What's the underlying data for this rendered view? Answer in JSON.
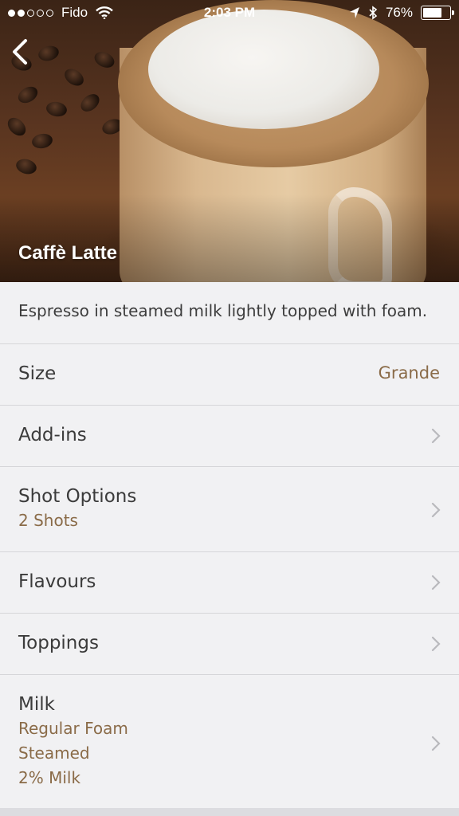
{
  "status_bar": {
    "carrier": "Fido",
    "time": "2:03 PM",
    "battery_percent": "76%",
    "battery_level": 0.76
  },
  "product": {
    "title": "Caffè Latte",
    "description": "Espresso in steamed milk lightly topped with foam."
  },
  "options": {
    "size": {
      "label": "Size",
      "value": "Grande"
    },
    "add_ins": {
      "label": "Add-ins"
    },
    "shot_options": {
      "label": "Shot Options",
      "sub": [
        "2 Shots"
      ]
    },
    "flavours": {
      "label": "Flavours"
    },
    "toppings": {
      "label": "Toppings"
    },
    "milk": {
      "label": "Milk",
      "sub": [
        "Regular Foam",
        "Steamed",
        "2% Milk"
      ]
    }
  },
  "icons": {
    "back": "chevron-left-icon",
    "row_arrow": "chevron-right-icon",
    "wifi": "wifi-icon",
    "location": "location-arrow-icon",
    "bluetooth": "bluetooth-icon",
    "battery": "battery-icon"
  },
  "colors": {
    "accent": "#8a6b48",
    "background": "#f1f1f3",
    "divider": "#d6d6d9"
  }
}
